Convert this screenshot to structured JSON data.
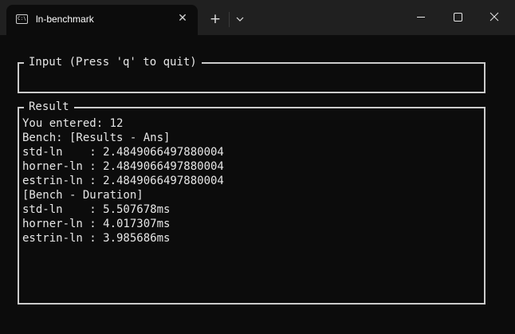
{
  "window": {
    "tab_title": "ln-benchmark",
    "tab_icon_text": "C:\\",
    "close_tab_glyph": "✕",
    "new_tab_glyph": "+",
    "icons": {
      "tab": "terminal-icon",
      "dropdown": "chevron-down-icon",
      "minimize": "minimize-icon",
      "maximize": "maximize-icon",
      "close": "close-icon"
    }
  },
  "terminal": {
    "input_panel": {
      "title": "Input (Press 'q' to quit)"
    },
    "result_panel": {
      "title": "Result",
      "lines": [
        "You entered: 12",
        "Bench: [Results - Ans]",
        "std-ln    : 2.4849066497880004",
        "horner-ln : 2.4849066497880004",
        "estrin-ln : 2.4849066497880004",
        "[Bench - Duration]",
        "std-ln    : 5.507678ms",
        "horner-ln : 4.017307ms",
        "estrin-ln : 3.985686ms"
      ]
    }
  },
  "colors": {
    "background": "#0c0c0c",
    "titlebar": "#202020",
    "text": "#e6e6e6",
    "border": "#cccccc"
  }
}
